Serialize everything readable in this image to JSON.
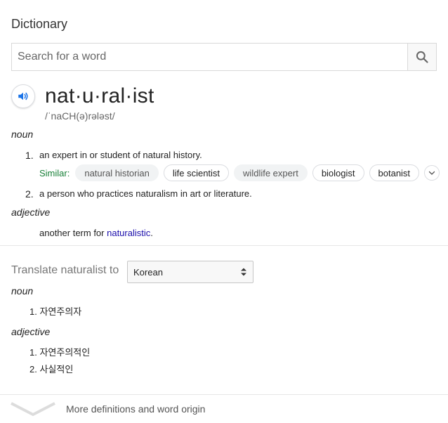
{
  "header": {
    "title": "Dictionary"
  },
  "search": {
    "placeholder": "Search for a word",
    "value": "",
    "button_icon": "search-icon"
  },
  "entry": {
    "word": "nat·u·ral·ist",
    "phonetic": "/ˈnaCH(ə)rələst/",
    "audio_icon": "speaker-icon",
    "noun": {
      "pos": "noun",
      "definitions": [
        {
          "num": "1.",
          "text": "an expert in or student of natural history.",
          "similar_label": "Similar:",
          "similar": [
            "natural historian",
            "life scientist",
            "wildlife expert",
            "biologist",
            "botanist"
          ]
        },
        {
          "num": "2.",
          "text": "a person who practices naturalism in art or literature."
        }
      ]
    },
    "adjective": {
      "pos": "adjective",
      "prefix": "another term for ",
      "link": "naturalistic",
      "suffix": "."
    }
  },
  "translate": {
    "label": "Translate naturalist to",
    "selected_language": "Korean",
    "noun": {
      "pos": "noun",
      "items": [
        "1. 자연주의자"
      ]
    },
    "adjective": {
      "pos": "adjective",
      "items": [
        "1. 자연주의적인",
        "2. 사실적인"
      ]
    }
  },
  "footer": {
    "more_label": "More definitions and word origin"
  },
  "colors": {
    "similar_label": "#188038",
    "link": "#1a0dab",
    "audio_icon": "#1a73e8"
  }
}
